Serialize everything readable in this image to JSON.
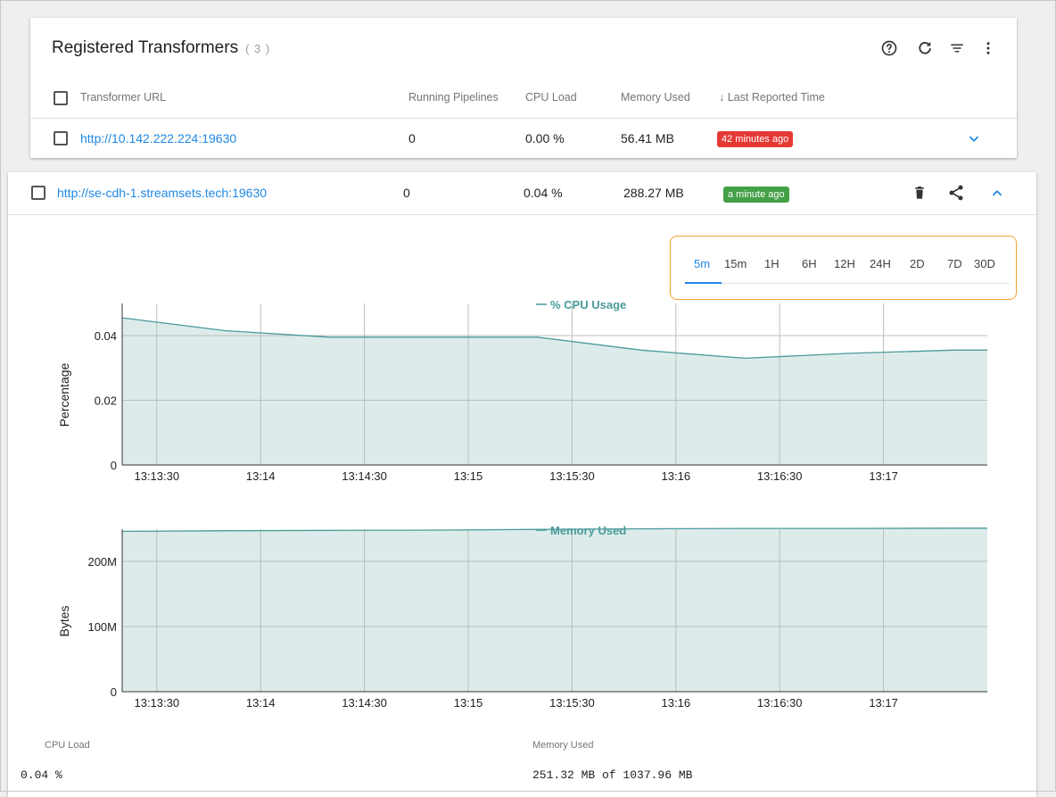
{
  "header": {
    "title": "Registered Transformers",
    "count": "( 3 )"
  },
  "columns": {
    "url": "Transformer URL",
    "pipelines": "Running Pipelines",
    "cpu": "CPU Load",
    "memory": "Memory Used",
    "last_reported": "Last Reported Time",
    "sort_arrow": "↓"
  },
  "rows": [
    {
      "url": "http://10.142.222.224:19630",
      "pipelines": "0",
      "cpu": "0.00 %",
      "memory": "56.41 MB",
      "last_reported": "42 minutes ago",
      "status_color": "#e53935"
    },
    {
      "url": "http://se-cdh-1.streamsets.tech:19630",
      "pipelines": "0",
      "cpu": "0.04 %",
      "memory": "288.27 MB",
      "last_reported": "a minute ago",
      "status_color": "#43a047"
    }
  ],
  "time_ranges": [
    "5m",
    "15m",
    "1H",
    "6H",
    "12H",
    "24H",
    "2D",
    "7D",
    "30D"
  ],
  "active_range": "5m",
  "icons": [
    "help-icon",
    "refresh-icon",
    "filter-icon",
    "more-vert-icon",
    "chevron-down-icon",
    "delete-icon",
    "share-icon",
    "chevron-up-icon",
    "sort-arrow-icon"
  ],
  "colors": {
    "accent": "#1e88e5",
    "series_line": "#4a9b9b",
    "series_fill": "#ddeceb",
    "range_highlight": "#f0a232"
  },
  "chart_data": [
    {
      "type": "area",
      "title": "",
      "legend": "% CPU Usage",
      "legend_position": "top-center",
      "xlabel": "",
      "ylabel": "Percentage",
      "x": [
        "13:13:20",
        "13:13:50",
        "13:14:20",
        "13:14:50",
        "13:15:20",
        "13:15:50",
        "13:16:20",
        "13:16:50",
        "13:17:20"
      ],
      "series": [
        {
          "name": "% CPU Usage",
          "values": [
            0.0455,
            0.0415,
            0.0395,
            0.0395,
            0.0395,
            0.0355,
            0.033,
            0.0345,
            0.0355
          ]
        }
      ],
      "x_ticks": [
        "13:13:30",
        "13:14",
        "13:14:30",
        "13:15",
        "13:15:30",
        "13:16",
        "13:16:30",
        "13:17"
      ],
      "y_ticks": [
        "0",
        "0.02",
        "0.04"
      ],
      "ylim": [
        0,
        0.04
      ],
      "grid": true
    },
    {
      "type": "area",
      "title": "",
      "legend": "Memory Used",
      "legend_position": "top-center",
      "xlabel": "",
      "ylabel": "Bytes",
      "x": [
        "13:13:20",
        "13:13:50",
        "13:14:20",
        "13:14:50",
        "13:15:20",
        "13:15:50",
        "13:16:20",
        "13:16:50",
        "13:17:20"
      ],
      "series": [
        {
          "name": "Memory Used",
          "values": [
            246000000,
            247000000,
            247500000,
            248000000,
            249000000,
            250000000,
            250500000,
            250500000,
            251000000
          ]
        }
      ],
      "x_ticks": [
        "13:13:30",
        "13:14",
        "13:14:30",
        "13:15",
        "13:15:30",
        "13:16",
        "13:16:30",
        "13:17"
      ],
      "y_ticks": [
        "0",
        "100M",
        "200M"
      ],
      "ylim": [
        0,
        200000000
      ],
      "grid": true
    }
  ],
  "stats": {
    "cpu_label": "CPU Load",
    "cpu_value": "0.04 %",
    "mem_label": "Memory Used",
    "mem_value": "251.32 MB of 1037.96 MB"
  }
}
